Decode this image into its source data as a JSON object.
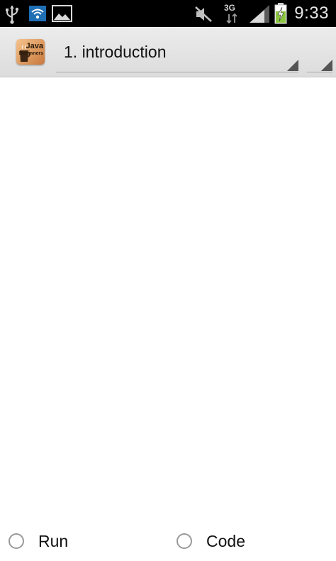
{
  "status_bar": {
    "time": "9:33",
    "network": "3G",
    "icons": [
      "usb-icon",
      "wifi-icon",
      "image-icon",
      "mute-icon",
      "data-3g-icon",
      "signal-icon",
      "battery-charging-icon"
    ]
  },
  "action_bar": {
    "app_icon_text_line1": "Java",
    "app_icon_text_line2": "Beginners",
    "spinner_selected": "1. introduction"
  },
  "radio_group": {
    "options": [
      {
        "label": "Run",
        "checked": false
      },
      {
        "label": "Code",
        "checked": false
      }
    ]
  },
  "colors": {
    "status_bar_bg": "#000000",
    "action_bar_bg": "#e4e4e4",
    "battery_green": "#8cc63f"
  }
}
